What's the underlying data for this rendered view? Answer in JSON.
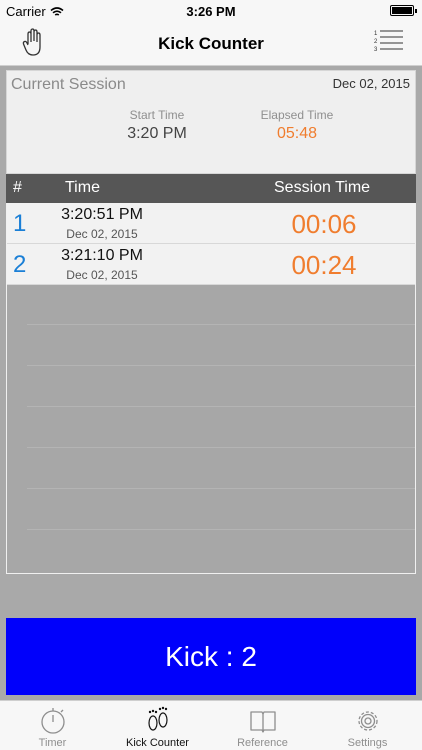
{
  "status_bar": {
    "carrier": "Carrier",
    "time": "3:26 PM"
  },
  "nav": {
    "title": "Kick Counter",
    "left_icon": "hand-icon",
    "right_icon": "numbered-list-icon"
  },
  "session": {
    "title": "Current Session",
    "date": "Dec 02, 2015",
    "start_label": "Start Time",
    "start_value": "3:20 PM",
    "elapsed_label": "Elapsed Time",
    "elapsed_value": "05:48"
  },
  "table": {
    "headers": {
      "index": "#",
      "time": "Time",
      "session_time": "Session Time"
    },
    "rows": [
      {
        "index": "1",
        "time": "3:20:51 PM",
        "date": "Dec 02, 2015",
        "session_time": "00:06"
      },
      {
        "index": "2",
        "time": "3:21:10 PM",
        "date": "Dec 02, 2015",
        "session_time": "00:24"
      }
    ]
  },
  "kick_button": {
    "label": "Kick : 2"
  },
  "tabs": [
    {
      "label": "Timer",
      "icon": "stopwatch-icon",
      "active": false
    },
    {
      "label": "Kick Counter",
      "icon": "footprints-icon",
      "active": true
    },
    {
      "label": "Reference",
      "icon": "book-icon",
      "active": false
    },
    {
      "label": "Settings",
      "icon": "gear-icon",
      "active": false
    }
  ],
  "colors": {
    "accent_orange": "#f07d2e",
    "index_blue": "#1a7fd6",
    "kick_button_blue": "#0000fb",
    "table_header": "#565656"
  }
}
